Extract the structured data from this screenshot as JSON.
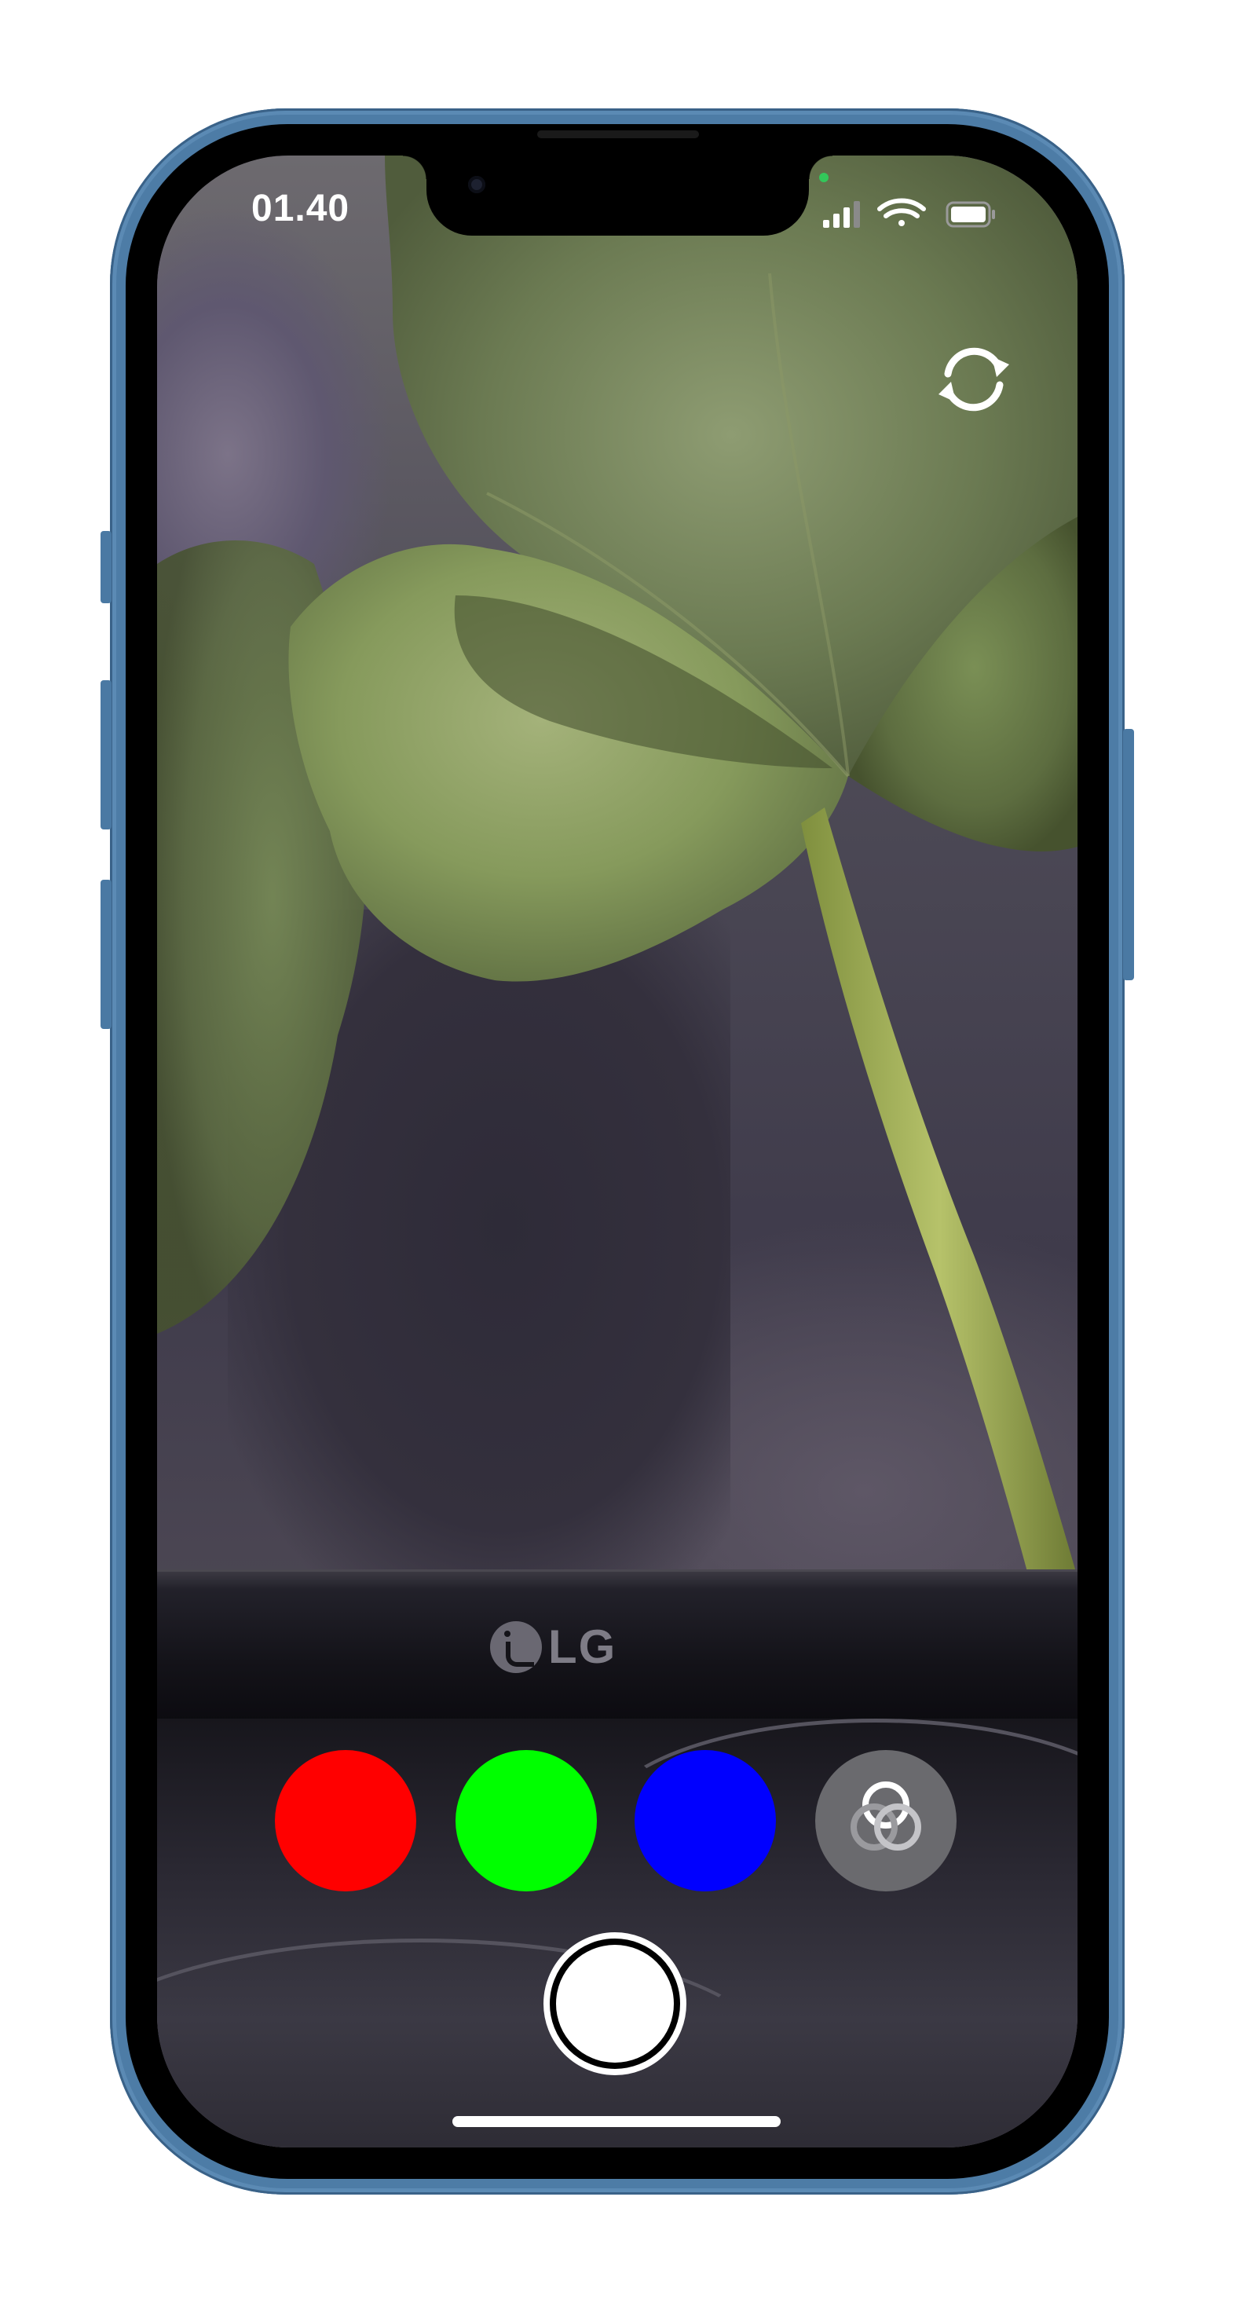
{
  "status_bar": {
    "time": "01.40",
    "signal_icon": "cellular-signal-icon",
    "wifi_icon": "wifi-icon",
    "battery_icon": "battery-icon",
    "privacy_indicator_color": "#33c75a"
  },
  "camera": {
    "flip_icon": "camera-flip-icon",
    "monitor_brand": "LG"
  },
  "color_filters": [
    {
      "name": "red",
      "color": "#ff0000"
    },
    {
      "name": "green",
      "color": "#00ff00"
    },
    {
      "name": "blue",
      "color": "#0000ff"
    },
    {
      "name": "mix",
      "icon": "color-overlap-icon",
      "color": "#6a6a6e"
    }
  ],
  "shutter": {
    "icon": "shutter-button"
  },
  "device": {
    "frame_color": "#4d7ca6"
  }
}
